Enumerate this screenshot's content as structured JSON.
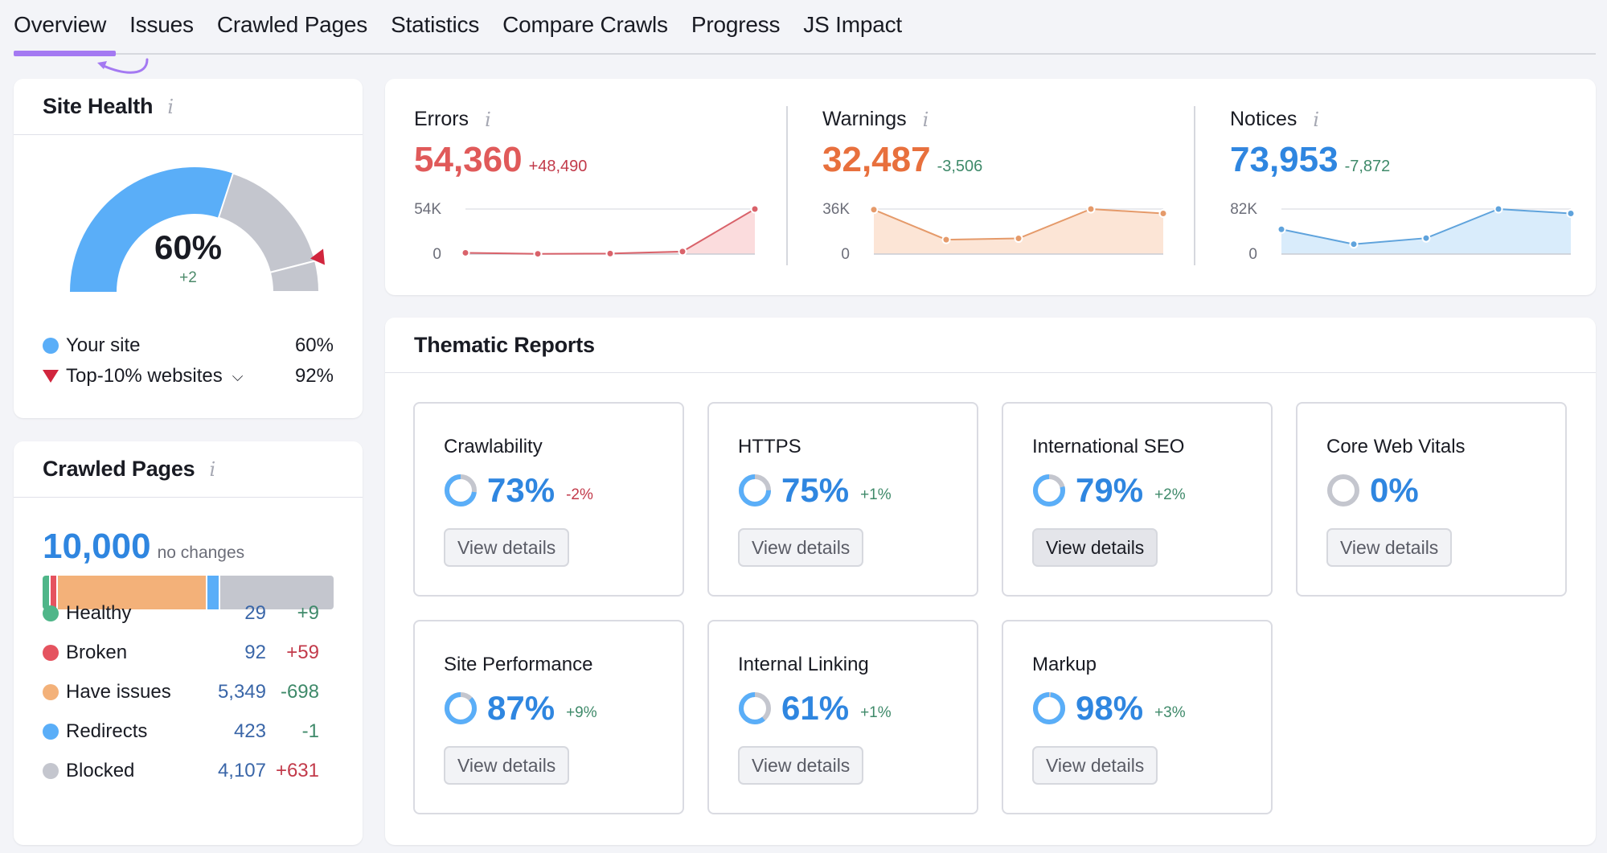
{
  "tabs": [
    {
      "label": "Overview",
      "active": true
    },
    {
      "label": "Issues"
    },
    {
      "label": "Crawled Pages"
    },
    {
      "label": "Statistics"
    },
    {
      "label": "Compare Crawls"
    },
    {
      "label": "Progress"
    },
    {
      "label": "JS Impact"
    }
  ],
  "site_health": {
    "title": "Site Health",
    "info_icon": "i",
    "value": "60%",
    "value_fraction": 0.6,
    "top10_fraction": 0.92,
    "delta": "+2",
    "legend": [
      {
        "label": "Your site",
        "value": "60%",
        "color": "#5aaef8",
        "marker": "dot"
      },
      {
        "label": "Top-10% websites",
        "value": "92%",
        "color": "#d1253d",
        "marker": "triangle-down",
        "has_dropdown": true
      }
    ],
    "colors": {
      "filled": "#5aaef8",
      "remaining": "#c4c6ce",
      "marker": "#d1253d"
    }
  },
  "crawled_pages": {
    "title": "Crawled Pages",
    "info_icon": "i",
    "total": "10,000",
    "total_sub": "no changes",
    "rows": [
      {
        "label": "Healthy",
        "count": "29",
        "change": "+9",
        "change_type": "pos",
        "color": "#4fb689",
        "share": 0.0029
      },
      {
        "label": "Broken",
        "count": "92",
        "change": "+59",
        "change_type": "neg",
        "color": "#e5535f",
        "share": 0.0092
      },
      {
        "label": "Have issues",
        "count": "5,349",
        "change": "-698",
        "change_type": "pos",
        "color": "#f3b179",
        "share": 0.5349
      },
      {
        "label": "Redirects",
        "count": "423",
        "change": "-1",
        "change_type": "pos",
        "color": "#5aaef8",
        "share": 0.0423
      },
      {
        "label": "Blocked",
        "count": "4,107",
        "change": "+631",
        "change_type": "neg",
        "color": "#c4c6ce",
        "share": 0.4107
      }
    ]
  },
  "issues": [
    {
      "label": "Errors",
      "value": "54,360",
      "delta": "+48,490",
      "delta_type": "neg",
      "color": "#e05a5a",
      "line_color": "#d9626a",
      "fill_color": "#fbdcdd",
      "y_max_label": "54K",
      "y_min_label": "0",
      "y_max": 54000,
      "points": [
        1500,
        300,
        600,
        3000,
        54360
      ]
    },
    {
      "label": "Warnings",
      "value": "32,487",
      "delta": "-3,506",
      "delta_type": "pos",
      "color": "#e8703d",
      "line_color": "#e59a6a",
      "fill_color": "#fce5d6",
      "y_max_label": "36K",
      "y_min_label": "0",
      "y_max": 36000,
      "points": [
        35500,
        11500,
        12500,
        36000,
        32487
      ]
    },
    {
      "label": "Notices",
      "value": "73,953",
      "delta": "-7,872",
      "delta_type": "pos",
      "color": "#2f86e0",
      "line_color": "#5fa3dc",
      "fill_color": "#d9ecfb",
      "y_max_label": "82K",
      "y_min_label": "0",
      "y_max": 82000,
      "points": [
        45000,
        18000,
        29000,
        82000,
        73953
      ]
    }
  ],
  "thematic": {
    "title": "Thematic Reports",
    "button_label": "View details",
    "reports": [
      {
        "name": "Crawlability",
        "value": "73%",
        "fraction": 0.73,
        "delta": "-2%",
        "delta_type": "neg"
      },
      {
        "name": "HTTPS",
        "value": "75%",
        "fraction": 0.75,
        "delta": "+1%",
        "delta_type": "pos"
      },
      {
        "name": "International SEO",
        "value": "79%",
        "fraction": 0.79,
        "delta": "+2%",
        "delta_type": "pos",
        "hovered": true
      },
      {
        "name": "Core Web Vitals",
        "value": "0%",
        "fraction": 0,
        "delta": "",
        "delta_type": ""
      },
      {
        "name": "Site Performance",
        "value": "87%",
        "fraction": 0.87,
        "delta": "+9%",
        "delta_type": "pos"
      },
      {
        "name": "Internal Linking",
        "value": "61%",
        "fraction": 0.61,
        "delta": "+1%",
        "delta_type": "pos"
      },
      {
        "name": "Markup",
        "value": "98%",
        "fraction": 0.98,
        "delta": "+3%",
        "delta_type": "pos"
      }
    ]
  }
}
